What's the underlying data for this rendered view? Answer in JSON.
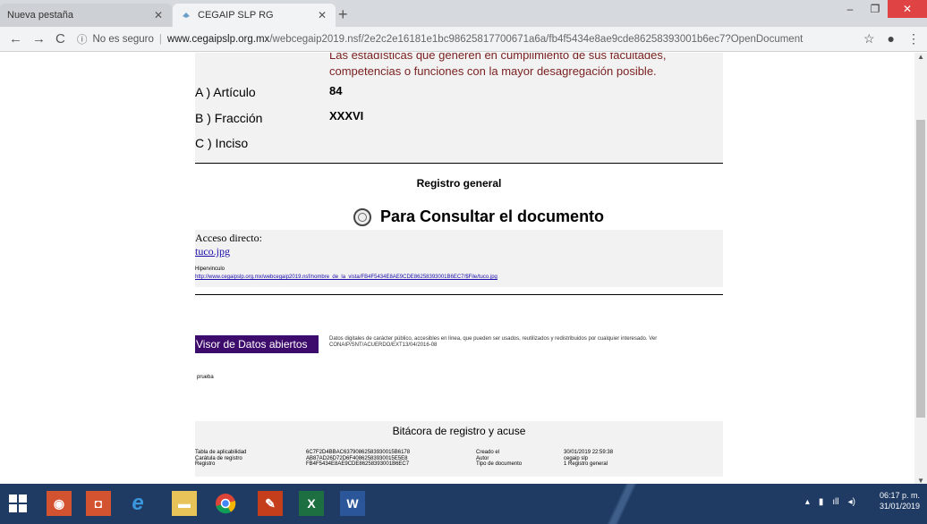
{
  "browser": {
    "tabs": [
      {
        "label": "Nueva pestaña"
      },
      {
        "label": "CEGAIP SLP RG"
      }
    ],
    "address": {
      "security": "No es seguro",
      "host": "www.cegaipslp.org.mx",
      "path": "/webcegaip2019.nsf/2e2c2e16181e1bc98625817700671a6a/fb4f5434e8ae9cde86258393001b6ec7?OpenDocument"
    }
  },
  "page": {
    "criteria_text": "Las estadísticas que generen en cumplimiento de sus facultades, competencias o funciones con la mayor desagregación posible.",
    "rows": [
      {
        "label": "A ) Artículo",
        "value": "84"
      },
      {
        "label": "B ) Fracción",
        "value": "XXXVI"
      },
      {
        "label": "C ) Inciso",
        "value": ""
      }
    ],
    "registro_title": "Registro general",
    "consult_title": "Para Consultar el documento",
    "acceso_label": "Acceso directo:",
    "acceso_link": "tuco.jpg",
    "hiper_label": "Hipervinculo",
    "hiper_link": "http://www.cegaipslp.org.mx/webcegaip2019.nsf/nombre_de_la_vista/FB4F5434E8AE9CDE86258393001B6EC7/$File/tuco.jpg",
    "visor_label": "Visor de Datos abiertos",
    "visor_text": "Datos digitales de carácter público, accesibles en línea, que pueden ser usados, reutilizados y redistribuidos por cualquier interesado. Ver CONAIP/SNT/ACUERDO/EXT13/04/2016-08",
    "prueba": "prueba",
    "bitacora": {
      "title": "Bitácora de registro y acuse",
      "col1_labels": [
        "Tabla de aplicabilidad",
        "Carátula de registro",
        "Registro"
      ],
      "col2_values": [
        "6C7F2D4BBAC63790862583930015B6178",
        "AB87AD26D72D6F40862583930015E5E8",
        "FB4F5434E8AE9CDE86258393001B6EC7"
      ],
      "col3_labels": [
        "Creado el",
        "Autor",
        "Tipo de documento"
      ],
      "col4_values": [
        "30/01/2019 22:59:38",
        "cegaip slp",
        "1 Registro general"
      ]
    }
  },
  "taskbar": {
    "time": "06:17 p. m.",
    "date": "31/01/2019"
  }
}
